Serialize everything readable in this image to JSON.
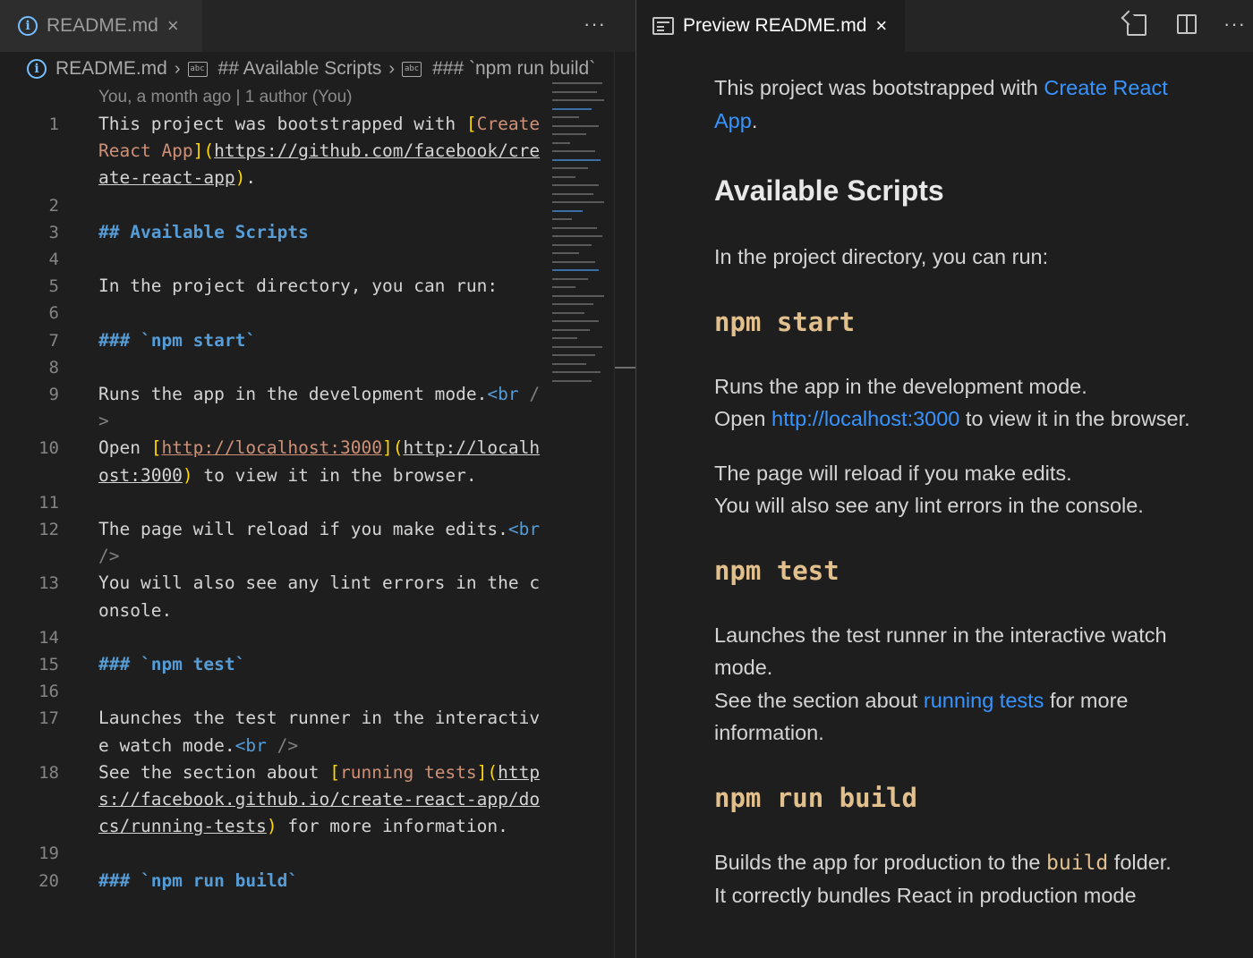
{
  "left_tab": {
    "label": "README.md"
  },
  "breadcrumb": {
    "file": "README.md",
    "item1": "## Available Scripts",
    "item2": "### `npm run build`",
    "abc": "abc"
  },
  "blame": "You, a month ago | 1 author (You)",
  "code": {
    "ln1": "1",
    "ln2": "2",
    "ln3": "3",
    "ln4": "4",
    "ln5": "5",
    "ln6": "6",
    "ln7": "7",
    "ln8": "8",
    "ln9": "9",
    "ln10": "10",
    "ln11": "11",
    "ln12": "12",
    "ln13": "13",
    "ln14": "14",
    "ln15": "15",
    "ln16": "16",
    "ln17": "17",
    "ln18": "18",
    "ln19": "19",
    "ln20": "20",
    "l1_a": "This project was bootstrapped with ",
    "l1_b": "[",
    "l1_c": "Create React App",
    "l1_d": "]",
    "l1_e": "(",
    "l1_f": "https://github.com/facebook/create-react-app",
    "l1_g": ")",
    "l1_h": ".",
    "l3": "## Available Scripts",
    "l5": "In the project directory, you can run:",
    "l7": "### `npm start`",
    "l9_a": "Runs the app in the development mode.",
    "l9_b": "<br",
    "l9_c": " />",
    "l10_a": "Open ",
    "l10_b": "[",
    "l10_c": "http://localhost:3000",
    "l10_d": "]",
    "l10_e": "(",
    "l10_f": "http://localhost:3000",
    "l10_g": ")",
    "l10_h": " to view it in the browser.",
    "l12_a": "The page will reload if you make edits.",
    "l12_b": "<br",
    "l12_c": " />",
    "l13": "You will also see any lint errors in the console.",
    "l15": "### `npm test`",
    "l17_a": "Launches the test runner in the interactive watch mode.",
    "l17_b": "<br",
    "l17_c": " />",
    "l18_a": "See the section about ",
    "l18_b": "[",
    "l18_c": "running tests",
    "l18_d": "]",
    "l18_e": "(",
    "l18_f": "https://facebook.github.io/create-react-app/docs/running-tests",
    "l18_g": ")",
    "l18_h": " for more information.",
    "l20": "### `npm run build`"
  },
  "right_tab": {
    "label": "Preview README.md"
  },
  "preview": {
    "p1_a": "This project was bootstrapped with ",
    "p1_link": "Create React App",
    "p1_b": ".",
    "h2": "Available Scripts",
    "p2": "In the project directory, you can run:",
    "h3_start": "npm start",
    "p3_a": "Runs the app in the development mode.",
    "p3_b": "Open ",
    "p3_link": "http://localhost:3000",
    "p3_c": " to view it in the browser.",
    "p4_a": "The page will reload if you make edits.",
    "p4_b": "You will also see any lint errors in the console.",
    "h3_test": "npm test",
    "p5_a": "Launches the test runner in the interactive watch mode.",
    "p5_b": "See the section about ",
    "p5_link": "running tests",
    "p5_c": " for more information.",
    "h3_build": "npm run build",
    "p6_a": "Builds the app for production to the ",
    "p6_code": "build",
    "p6_b": " folder.",
    "p6_c": "It correctly bundles React in production mode"
  },
  "colors": {
    "heading": "#569cd6",
    "link_text": "#ce9178",
    "bracket": "#ffd700",
    "preview_link": "#3794ff",
    "preview_code": "#e2c08d"
  },
  "icons": {
    "info": "info-icon",
    "close": "close-icon",
    "more": "more-icon",
    "symbol": "abc-symbol-icon",
    "preview": "preview-icon",
    "open_source": "open-source-icon",
    "split": "split-editor-icon"
  },
  "glyphs": {
    "info": "i",
    "close": "×",
    "more": "···",
    "chevron": "›"
  }
}
